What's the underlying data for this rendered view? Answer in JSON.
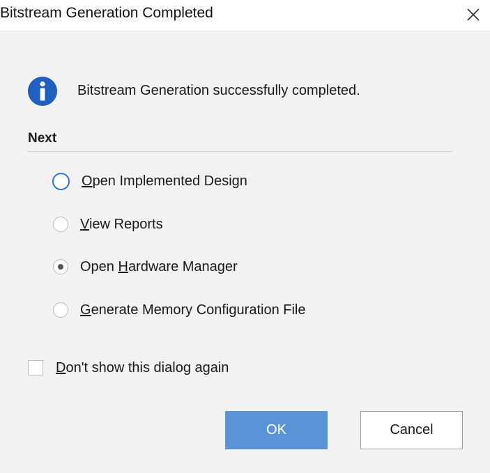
{
  "window": {
    "title": "Bitstream Generation Completed",
    "close_icon": "close-icon"
  },
  "message": {
    "icon": "info-icon",
    "text": "Bitstream Generation successfully completed."
  },
  "next": {
    "label": "Next",
    "options": [
      {
        "pre": "",
        "mn": "O",
        "post": "pen Implemented Design",
        "checked": false,
        "focused": true
      },
      {
        "pre": "",
        "mn": "V",
        "post": "iew Reports",
        "checked": false,
        "focused": false
      },
      {
        "pre": "Open ",
        "mn": "H",
        "post": "ardware Manager",
        "checked": true,
        "focused": false
      },
      {
        "pre": "",
        "mn": "G",
        "post": "enerate Memory Configuration File",
        "checked": false,
        "focused": false
      }
    ]
  },
  "dont_show": {
    "pre": "",
    "mn": "D",
    "post": "on't show this dialog again",
    "checked": false
  },
  "buttons": {
    "ok": "OK",
    "cancel": "Cancel"
  },
  "colors": {
    "accent": "#2d78d6",
    "ok_button": "#5b93d9",
    "info_icon": "#1f5fbf",
    "dialog_background": "#f2f2f2"
  }
}
